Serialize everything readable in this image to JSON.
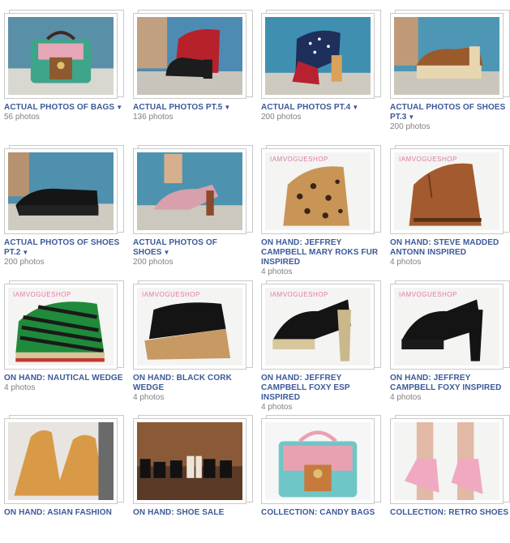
{
  "caret": "▼",
  "albums": [
    {
      "title": "ACTUAL PHOTOS OF BAGS",
      "caret": true,
      "count": "56 photos",
      "thumb": "bag-green"
    },
    {
      "title": "ACTUAL PHOTOS PT.5",
      "caret": true,
      "count": "136 photos",
      "thumb": "shoe-red-studs"
    },
    {
      "title": "ACTUAL PHOTOS PT.4",
      "caret": true,
      "count": "200 photos",
      "thumb": "shoe-flag"
    },
    {
      "title": "ACTUAL PHOTOS OF SHOES PT.3",
      "caret": true,
      "count": "200 photos",
      "thumb": "shoe-brown-platform"
    },
    {
      "title": "ACTUAL PHOTOS OF SHOES PT.2",
      "caret": true,
      "count": "200 photos",
      "thumb": "shoe-black-wedge"
    },
    {
      "title": "ACTUAL PHOTOS OF SHOES",
      "caret": true,
      "count": "200 photos",
      "thumb": "shoe-pink-heel"
    },
    {
      "title": "ON HAND: JEFFREY CAMPBELL MARY ROKS FUR INSPIRED",
      "caret": false,
      "count": "4 photos",
      "thumb": "bootie-leopard",
      "brand": "IAMVOGUESHOP"
    },
    {
      "title": "ON HAND: STEVE MADDED ANTONN INSPIRED",
      "caret": false,
      "count": "4 photos",
      "thumb": "bootie-brown",
      "brand": "IAMVOGUESHOP"
    },
    {
      "title": "ON HAND: NAUTICAL WEDGE",
      "caret": false,
      "count": "4 photos",
      "thumb": "wedge-striped",
      "brand": "IAMVOGUESHOP"
    },
    {
      "title": "ON HAND: BLACK CORK WEDGE",
      "caret": false,
      "count": "4 photos",
      "thumb": "wedge-cork",
      "brand": "IAMVOGUESHOP"
    },
    {
      "title": "ON HAND: JEFFREY CAMPBELL FOXY ESP INSPIRED",
      "caret": false,
      "count": "4 photos",
      "thumb": "heel-black-snake",
      "brand": "IAMVOGUESHOP"
    },
    {
      "title": "ON HAND: JEFFREY CAMPBELL FOXY INSPIRED",
      "caret": false,
      "count": "4 photos",
      "thumb": "heel-black",
      "brand": "IAMVOGUESHOP"
    },
    {
      "title": "ON HAND: ASIAN FASHION",
      "caret": false,
      "count": "",
      "thumb": "oxford-tan"
    },
    {
      "title": "ON HAND: SHOE SALE",
      "caret": false,
      "count": "",
      "thumb": "shoe-row"
    },
    {
      "title": "COLLECTION: CANDY BAGS",
      "caret": false,
      "count": "",
      "thumb": "bag-candy"
    },
    {
      "title": "COLLECTION: RETRO SHOES",
      "caret": false,
      "count": "",
      "thumb": "shoe-retro-pink"
    }
  ]
}
